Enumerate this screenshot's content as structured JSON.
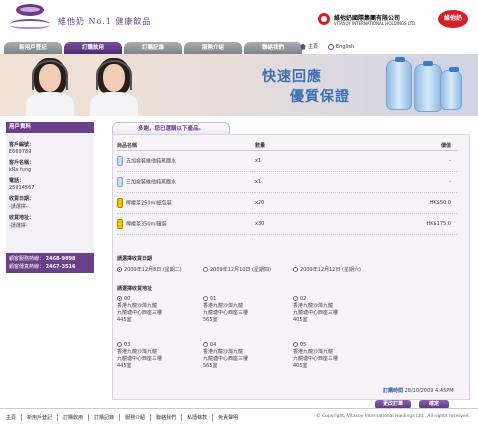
{
  "header": {
    "logo_text": "維他奶 No.1 健康飲品",
    "brand_cn": "維他奶國際集團有限公司",
    "brand_en": "VITASOY INTERNATIONAL HOLDINGS LTD.",
    "brand_badge": "維他奶"
  },
  "nav": {
    "tabs": [
      {
        "label": "新用戶登記"
      },
      {
        "label": "訂購飲用"
      },
      {
        "label": "訂購記錄"
      },
      {
        "label": "服務介紹"
      },
      {
        "label": "聯絡我們"
      }
    ],
    "active_tab": 1,
    "home_label": "主頁",
    "english_label": "English"
  },
  "banner": {
    "slogan_line1": "快速回應",
    "slogan_line2": "優質保證"
  },
  "sidebar": {
    "title": "用戶資料",
    "fields": [
      {
        "label": "客戶編號：",
        "value": "E669789"
      },
      {
        "label": "客戶名稱：",
        "value": "kRa fung"
      },
      {
        "label": "電話：",
        "value": "25914567"
      },
      {
        "label": "收貨日期：",
        "value": "-請選擇-"
      },
      {
        "label": "收貨地址：",
        "value": "-請選擇-"
      }
    ],
    "hotline1_label": "顧客服務熱線：",
    "hotline1_value": "2468-9898",
    "hotline2_label": "顧客傳真熱線：",
    "hotline2_value": "2467-3516"
  },
  "main": {
    "tab_label": "多謝，您已選購以下產品。",
    "table": {
      "headers": [
        "商品名稱",
        "數量",
        "價值"
      ],
      "rows": [
        {
          "name": "五加侖裝維他純蒸餾水",
          "qty": "x1",
          "price": "-",
          "icon": "water-bottle-icon"
        },
        {
          "name": "三加侖裝維他純蒸餾水",
          "qty": "x1",
          "price": "-",
          "icon": "water-bottle-icon"
        },
        {
          "name": "檸檬茶250ml紙包裝",
          "qty": "x20",
          "price": "HK$50.0",
          "icon": "lemon-tea-pack-icon"
        },
        {
          "name": "檸檬茶350ml罐裝",
          "qty": "x30",
          "price": "HK$175.0",
          "icon": "lemon-tea-can-icon"
        }
      ]
    },
    "date_section_label": "請選擇收貨日期",
    "date_options": [
      {
        "label": "2009年12月8日 (星期二)",
        "selected": true
      },
      {
        "label": "2009年12月10日 (星期四)",
        "selected": false
      },
      {
        "label": "2009年12月12日 (星期六)",
        "selected": false
      }
    ],
    "address_section_label": "請選擇收貨地址",
    "addresses": [
      {
        "id": "00",
        "line1": "香港九龍沙灣九龍",
        "line2": "九龍塘中心西座三樓",
        "line3": "445室",
        "selected": true
      },
      {
        "id": "01",
        "line1": "香港九龍沙灣九龍",
        "line2": "九龍塘中心西座三樓",
        "line3": "565室",
        "selected": false
      },
      {
        "id": "02",
        "line1": "香港九龍沙灣九龍",
        "line2": "九龍塘中心西座三樓",
        "line3": "405室",
        "selected": false
      },
      {
        "id": "03",
        "line1": "香港九龍沙灣九龍",
        "line2": "九龍塘中心西座三樓",
        "line3": "445室",
        "selected": false
      },
      {
        "id": "04",
        "line1": "香港九龍沙灣九龍",
        "line2": "九龍塘中心西座三樓",
        "line3": "565室",
        "selected": false
      },
      {
        "id": "05",
        "line1": "香港九龍沙灣九龍",
        "line2": "九龍塘中心西座三樓",
        "line3": "405室",
        "selected": false
      }
    ],
    "order_time_label": "訂購時間",
    "order_time_value": "28/10/2009 4:45PM",
    "back_button": "更改訂單",
    "confirm_button": "確定"
  },
  "footer": {
    "links": [
      "主頁",
      "新用戶登記",
      "訂購飲用",
      "訂購記錄",
      "服務介紹",
      "聯絡我們",
      "私隱條款",
      "免責聲明"
    ],
    "copyright": "© Copyright, Vitasoy International Holdings Ltd., All rights reserved."
  },
  "colors": {
    "brand_purple": "#6b3f8a",
    "brand_red": "#d32027",
    "slogan_blue": "#3c6fb0"
  }
}
